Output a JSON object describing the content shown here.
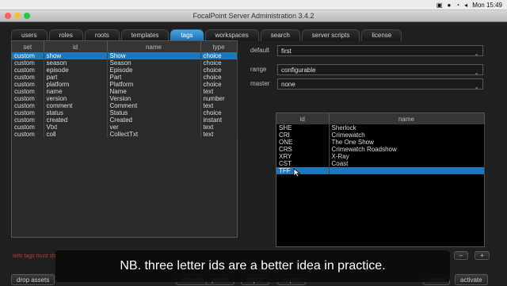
{
  "mac_menu": {
    "icons": [
      "menubar-status-icon-1",
      "menubar-status-icon-2",
      "wifi-icon",
      "volume-icon"
    ],
    "time": "Mon 15:49"
  },
  "window": {
    "title": "FocalPoint Server Administration 3.4.2"
  },
  "tabs": [
    {
      "label": "users"
    },
    {
      "label": "roles"
    },
    {
      "label": "roots"
    },
    {
      "label": "templates"
    },
    {
      "label": "tags",
      "active": true
    },
    {
      "label": "workspaces"
    },
    {
      "label": "search"
    },
    {
      "label": "server scripts"
    },
    {
      "label": "license"
    }
  ],
  "left_table": {
    "headers": [
      "set",
      "id",
      "name",
      "type"
    ],
    "rows": [
      {
        "set": "custom",
        "id": "show",
        "name": "Show",
        "type": "choice",
        "selected": true
      },
      {
        "set": "custom",
        "id": "season",
        "name": "Season",
        "type": "choice"
      },
      {
        "set": "custom",
        "id": "episode",
        "name": "Episode",
        "type": "choice"
      },
      {
        "set": "custom",
        "id": "part",
        "name": "Part",
        "type": "choice"
      },
      {
        "set": "custom",
        "id": "platform",
        "name": "Platform",
        "type": "choice"
      },
      {
        "set": "custom",
        "id": "name",
        "name": "Name",
        "type": "text"
      },
      {
        "set": "custom",
        "id": "version",
        "name": "Version",
        "type": "number"
      },
      {
        "set": "custom",
        "id": "comment",
        "name": "Comment",
        "type": "text"
      },
      {
        "set": "custom",
        "id": "status",
        "name": "Status",
        "type": "choice"
      },
      {
        "set": "custom",
        "id": "created",
        "name": "Created",
        "type": "instant"
      },
      {
        "set": "custom",
        "id": "Vtxt",
        "name": "ver",
        "type": "text"
      },
      {
        "set": "custom",
        "id": "coll",
        "name": "CollectTxt",
        "type": "text"
      }
    ]
  },
  "right_form": {
    "default_label": "default",
    "default_value": "first",
    "range_label": "range",
    "range_value": "configurable",
    "master_label": "master",
    "master_value": "none"
  },
  "right_table": {
    "headers": [
      "id",
      "name"
    ],
    "rows": [
      {
        "id": "SHE",
        "name": "Sherlock"
      },
      {
        "id": "CRI",
        "name": "Crimewatch"
      },
      {
        "id": "ONE",
        "name": "The One Show"
      },
      {
        "id": "CRS",
        "name": "Crimewatch Roadshow"
      },
      {
        "id": "XRY",
        "name": "X-Ray"
      },
      {
        "id": "CST",
        "name": "Coast"
      },
      {
        "id": "TFF",
        "name": "",
        "selected": true
      }
    ]
  },
  "bottom": {
    "left_link": "tells tags must sh",
    "minus": "–",
    "plus": "+",
    "drop_assets": "drop assets",
    "schema": "schema",
    "preset": "preset",
    "import": "import",
    "export": "export",
    "revert": "revert",
    "activate": "activate"
  },
  "caption": "NB. three letter ids are a better idea in practice."
}
